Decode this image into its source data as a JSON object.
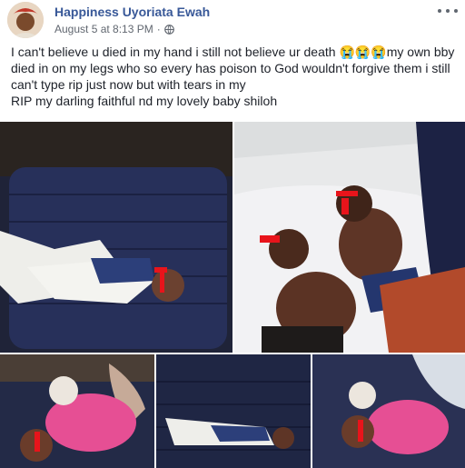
{
  "post": {
    "author": "Happiness Uyoriata Ewah",
    "timestamp": "August 5 at 8:13 PM",
    "separator": "·",
    "privacy_icon": "globe-icon",
    "more_icon": "more-options-icon",
    "caption_line1": "I can't believe u died in my hand i still not believe ur death 😭😭😭my own bby died in on my legs who so every has poison to God wouldn't forgive them i still can't type rip just now but with tears in my",
    "caption_line2": "RIP my darling faithful nd my lovely baby shiloh"
  },
  "photos": [
    {
      "name": "photo-1",
      "subject": "child lying on dark sofa"
    },
    {
      "name": "photo-2",
      "subject": "two children lying on floor"
    },
    {
      "name": "photo-3",
      "subject": "child in pink dress on sofa"
    },
    {
      "name": "photo-4",
      "subject": "child on dark sofa"
    },
    {
      "name": "photo-5",
      "subject": "child in pink dress lying down"
    }
  ],
  "colors": {
    "link": "#385898",
    "text": "#1d2129",
    "meta": "#616770",
    "redaction": "#e8141b"
  }
}
